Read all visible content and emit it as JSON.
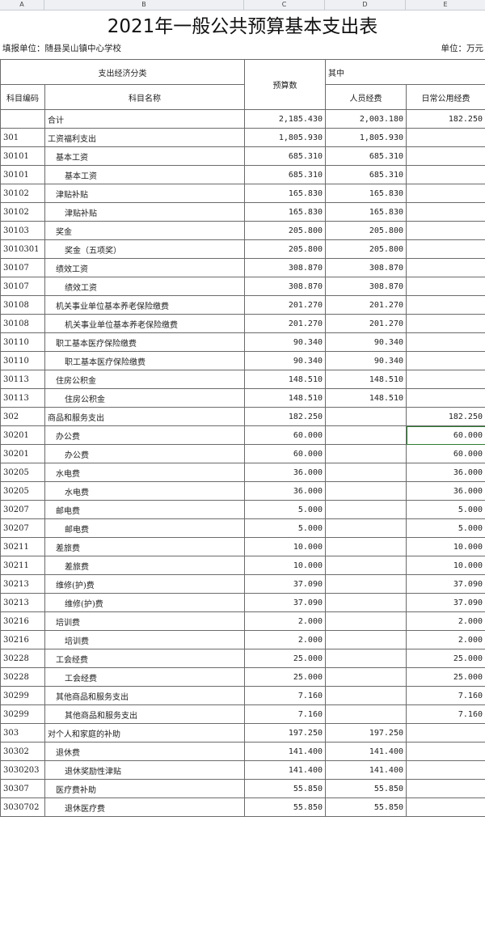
{
  "sheet": {
    "columns": [
      "A",
      "B",
      "C",
      "D",
      "E"
    ]
  },
  "doc": {
    "title": "2021年一般公共预算基本支出表",
    "unit_left": "填报单位：随县吴山镇中心学校",
    "unit_right": "单位：万元"
  },
  "header": {
    "group": "支出经济分类",
    "budget": "预算数",
    "among": "其中",
    "code": "科目编码",
    "name": "科目名称",
    "personnel": "人员经费",
    "public": "日常公用经费"
  },
  "rows": [
    {
      "code": "",
      "name": "合计",
      "level": 0,
      "budget": "2,185.430",
      "personnel": "2,003.180",
      "public": "182.250"
    },
    {
      "code": "301",
      "name": "工资福利支出",
      "level": 0,
      "budget": "1,805.930",
      "personnel": "1,805.930",
      "public": ""
    },
    {
      "code": "30101",
      "name": "基本工资",
      "level": 1,
      "budget": "685.310",
      "personnel": "685.310",
      "public": ""
    },
    {
      "code": "30101",
      "name": "基本工资",
      "level": 2,
      "budget": "685.310",
      "personnel": "685.310",
      "public": ""
    },
    {
      "code": "30102",
      "name": "津贴补贴",
      "level": 1,
      "budget": "165.830",
      "personnel": "165.830",
      "public": ""
    },
    {
      "code": "30102",
      "name": "津贴补贴",
      "level": 2,
      "budget": "165.830",
      "personnel": "165.830",
      "public": ""
    },
    {
      "code": "30103",
      "name": "奖金",
      "level": 1,
      "budget": "205.800",
      "personnel": "205.800",
      "public": ""
    },
    {
      "code": "3010301",
      "name": "奖金（五项奖）",
      "level": 2,
      "budget": "205.800",
      "personnel": "205.800",
      "public": ""
    },
    {
      "code": "30107",
      "name": "绩效工资",
      "level": 1,
      "budget": "308.870",
      "personnel": "308.870",
      "public": ""
    },
    {
      "code": "30107",
      "name": "绩效工资",
      "level": 2,
      "budget": "308.870",
      "personnel": "308.870",
      "public": ""
    },
    {
      "code": "30108",
      "name": "机关事业单位基本养老保险缴费",
      "level": 1,
      "budget": "201.270",
      "personnel": "201.270",
      "public": ""
    },
    {
      "code": "30108",
      "name": "机关事业单位基本养老保险缴费",
      "level": 2,
      "budget": "201.270",
      "personnel": "201.270",
      "public": ""
    },
    {
      "code": "30110",
      "name": "职工基本医疗保险缴费",
      "level": 1,
      "budget": "90.340",
      "personnel": "90.340",
      "public": ""
    },
    {
      "code": "30110",
      "name": "职工基本医疗保险缴费",
      "level": 2,
      "budget": "90.340",
      "personnel": "90.340",
      "public": ""
    },
    {
      "code": "30113",
      "name": "住房公积金",
      "level": 1,
      "budget": "148.510",
      "personnel": "148.510",
      "public": ""
    },
    {
      "code": "30113",
      "name": "住房公积金",
      "level": 2,
      "budget": "148.510",
      "personnel": "148.510",
      "public": ""
    },
    {
      "code": "302",
      "name": "商品和服务支出",
      "level": 0,
      "budget": "182.250",
      "personnel": "",
      "public": "182.250"
    },
    {
      "code": "30201",
      "name": "办公费",
      "level": 1,
      "budget": "60.000",
      "personnel": "",
      "public": "60.000",
      "selected": true
    },
    {
      "code": "30201",
      "name": "办公费",
      "level": 2,
      "budget": "60.000",
      "personnel": "",
      "public": "60.000"
    },
    {
      "code": "30205",
      "name": "水电费",
      "level": 1,
      "budget": "36.000",
      "personnel": "",
      "public": "36.000"
    },
    {
      "code": "30205",
      "name": "水电费",
      "level": 2,
      "budget": "36.000",
      "personnel": "",
      "public": "36.000"
    },
    {
      "code": "30207",
      "name": "邮电费",
      "level": 1,
      "budget": "5.000",
      "personnel": "",
      "public": "5.000"
    },
    {
      "code": "30207",
      "name": "邮电费",
      "level": 2,
      "budget": "5.000",
      "personnel": "",
      "public": "5.000"
    },
    {
      "code": "30211",
      "name": "差旅费",
      "level": 1,
      "budget": "10.000",
      "personnel": "",
      "public": "10.000"
    },
    {
      "code": "30211",
      "name": "差旅费",
      "level": 2,
      "budget": "10.000",
      "personnel": "",
      "public": "10.000"
    },
    {
      "code": "30213",
      "name": "维修(护)费",
      "level": 1,
      "budget": "37.090",
      "personnel": "",
      "public": "37.090"
    },
    {
      "code": "30213",
      "name": "维修(护)费",
      "level": 2,
      "budget": "37.090",
      "personnel": "",
      "public": "37.090"
    },
    {
      "code": "30216",
      "name": "培训费",
      "level": 1,
      "budget": "2.000",
      "personnel": "",
      "public": "2.000"
    },
    {
      "code": "30216",
      "name": "培训费",
      "level": 2,
      "budget": "2.000",
      "personnel": "",
      "public": "2.000"
    },
    {
      "code": "30228",
      "name": "工会经费",
      "level": 1,
      "budget": "25.000",
      "personnel": "",
      "public": "25.000"
    },
    {
      "code": "30228",
      "name": "工会经费",
      "level": 2,
      "budget": "25.000",
      "personnel": "",
      "public": "25.000"
    },
    {
      "code": "30299",
      "name": "其他商品和服务支出",
      "level": 1,
      "budget": "7.160",
      "personnel": "",
      "public": "7.160"
    },
    {
      "code": "30299",
      "name": "其他商品和服务支出",
      "level": 2,
      "budget": "7.160",
      "personnel": "",
      "public": "7.160"
    },
    {
      "code": "303",
      "name": "对个人和家庭的补助",
      "level": 0,
      "budget": "197.250",
      "personnel": "197.250",
      "public": ""
    },
    {
      "code": "30302",
      "name": "退休费",
      "level": 1,
      "budget": "141.400",
      "personnel": "141.400",
      "public": ""
    },
    {
      "code": "3030203",
      "name": "退休奖励性津贴",
      "level": 2,
      "budget": "141.400",
      "personnel": "141.400",
      "public": ""
    },
    {
      "code": "30307",
      "name": "医疗费补助",
      "level": 1,
      "budget": "55.850",
      "personnel": "55.850",
      "public": ""
    },
    {
      "code": "3030702",
      "name": "退休医疗费",
      "level": 2,
      "budget": "55.850",
      "personnel": "55.850",
      "public": ""
    }
  ]
}
